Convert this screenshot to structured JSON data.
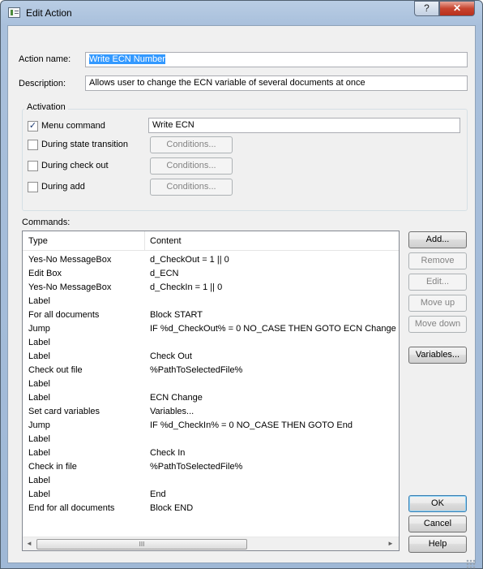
{
  "window": {
    "title": "Edit Action",
    "help_label": "?",
    "close_label": "✕"
  },
  "form": {
    "action_name_label": "Action name:",
    "action_name_value": "Write ECN Number",
    "description_label": "Description:",
    "description_value": "Allows user to change the ECN variable of several documents at once"
  },
  "activation": {
    "title": "Activation",
    "menu_command_label": "Menu command",
    "menu_command_checked": true,
    "menu_command_value": "Write ECN",
    "check_mark": "✓",
    "state_transition_label": "During state transition",
    "check_out_label": "During check out",
    "add_label": "During add",
    "conditions_label": "Conditions..."
  },
  "commands": {
    "label": "Commands:",
    "columns": [
      "Type",
      "Content"
    ],
    "rows": [
      [
        "Yes-No MessageBox",
        "d_CheckOut = 1 || 0"
      ],
      [
        "Edit Box",
        "d_ECN"
      ],
      [
        "Yes-No MessageBox",
        "d_CheckIn = 1 || 0"
      ],
      [
        "Label",
        ""
      ],
      [
        "For all documents",
        "Block START"
      ],
      [
        "Jump",
        "IF %d_CheckOut% = 0 NO_CASE THEN GOTO ECN Change"
      ],
      [
        "Label",
        ""
      ],
      [
        "Label",
        "Check Out"
      ],
      [
        "Check out file",
        "%PathToSelectedFile%"
      ],
      [
        "Label",
        ""
      ],
      [
        "Label",
        "ECN Change"
      ],
      [
        "Set card variables",
        "Variables..."
      ],
      [
        "Jump",
        "IF %d_CheckIn% = 0 NO_CASE THEN GOTO End"
      ],
      [
        "Label",
        ""
      ],
      [
        "Label",
        "Check In"
      ],
      [
        "Check in file",
        "%PathToSelectedFile%"
      ],
      [
        "Label",
        ""
      ],
      [
        "Label",
        "End"
      ],
      [
        "End for all documents",
        "Block END"
      ]
    ],
    "scroll_left": "◄",
    "scroll_right": "►",
    "thumb_grip": "III"
  },
  "buttons": {
    "add": "Add...",
    "remove": "Remove",
    "edit": "Edit...",
    "move_up": "Move up",
    "move_down": "Move down",
    "variables": "Variables...",
    "ok": "OK",
    "cancel": "Cancel",
    "help": "Help"
  }
}
